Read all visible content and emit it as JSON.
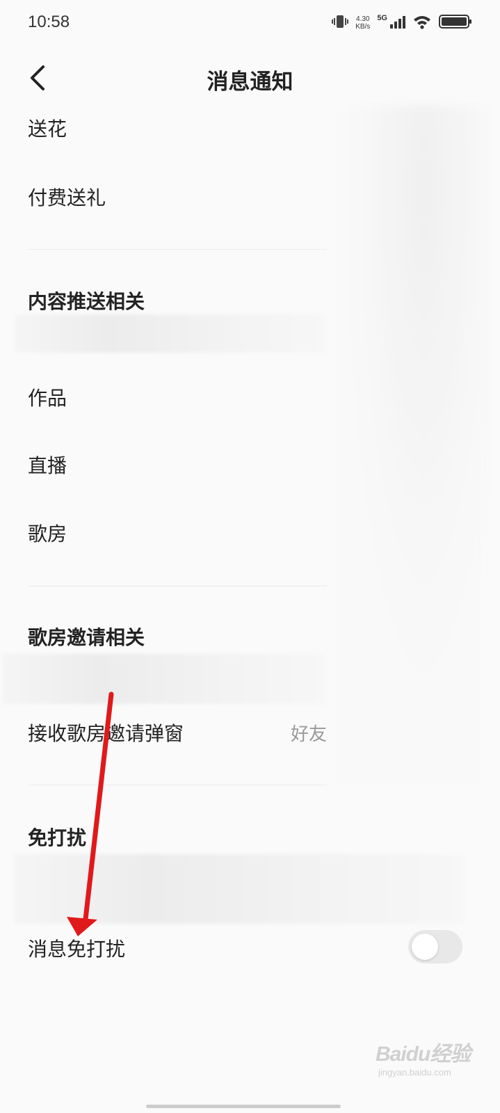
{
  "status_bar": {
    "time": "10:58",
    "net_speed_value": "4.30",
    "net_speed_unit": "KB/s",
    "network": "5G",
    "icons": [
      "vibrate-icon",
      "signal-icon",
      "wifi-icon",
      "battery-icon"
    ]
  },
  "header": {
    "title": "消息通知",
    "back_icon": "chevron-left-icon"
  },
  "list": {
    "items_gifts": [
      {
        "label": "送花"
      },
      {
        "label": "付费送礼"
      }
    ],
    "section_content_push": "内容推送相关",
    "items_content": [
      {
        "label": "作品"
      },
      {
        "label": "直播"
      },
      {
        "label": "歌房"
      }
    ],
    "section_room_invite": "歌房邀请相关",
    "room_invite": {
      "label": "接收歌房邀请弹窗",
      "value": "好友"
    },
    "section_dnd": "免打扰",
    "dnd": {
      "label": "消息免打扰",
      "toggle_on": false
    }
  },
  "watermark": {
    "logo": "Baidu经验",
    "url": "jingyan.baidu.com"
  },
  "colors": {
    "background": "#fafafa",
    "annotation_arrow": "#e0191b",
    "toggle_off": "#e8e8e8"
  }
}
